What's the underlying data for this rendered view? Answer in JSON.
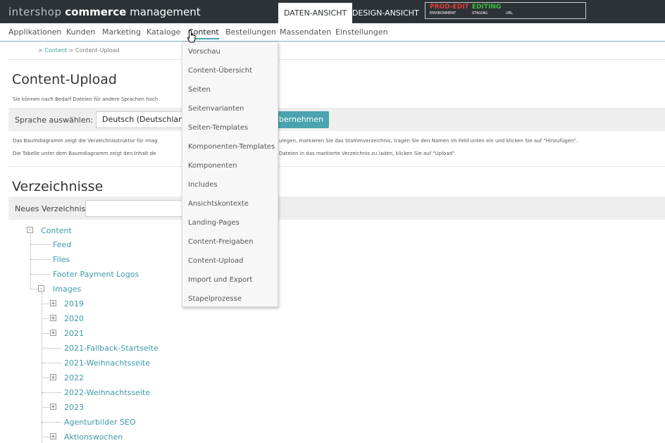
{
  "header": {
    "brand": "intershop",
    "commerce": "commerce",
    "management": "management",
    "view_daten": "DATEN-ANSICHT",
    "view_design": "DESIGN-ANSICHT",
    "env": {
      "environment_value": "PROD-EDIT",
      "staging_value": "EDITING",
      "environment_label": "ENVIRONMENT",
      "staging_label": "STAGING",
      "url_label": "URL"
    }
  },
  "nav": {
    "items": [
      "Applikationen",
      "Kunden",
      "Marketing",
      "Kataloge",
      "Content",
      "Bestellungen",
      "Massendaten",
      "Einstellungen"
    ],
    "active": "Content"
  },
  "breadcrumb": {
    "sep": ">",
    "content": "Content",
    "current": "Content-Upload"
  },
  "page": {
    "title": "Content-Upload",
    "note": "Sie können nach Bedarf Dateien für andere Sprachen hoch",
    "lang_label": "Sprache auswählen:",
    "lang_value": "Deutsch (Deutschland)",
    "apply_button": "Übernehmen",
    "info1_start": "Das Baumdiagramm zeigt die Verzeichnisstruktur für imag",
    "info1_end": "ulegen, markieren Sie das Stammverzeichnis, tragen Sie den Namen im Feld unten ein und klicken Sie auf \"Hinzufügen\".",
    "info2_start": "Die Tabelle unter dem Baumdiagramm zeigt den Inhalt de",
    "info2_end": "Dateien in das markierte Verzeichnis zu laden, klicken Sie auf \"Upload\".",
    "section_title": "Verzeichnisse",
    "new_dir_label": "Neues Verzeichnis:"
  },
  "tree": {
    "root": "Content",
    "level1": [
      "Feed",
      "Files",
      "Footer Payment Logos",
      "Images"
    ],
    "images_children": [
      "2019",
      "2020",
      "2021",
      "2021-Fallback-Startseite",
      "2021-Weihnachtsseite",
      "2022",
      "2022-Weihnachtsseite",
      "2023",
      "Agenturbilder SEO",
      "Aktionswochen"
    ],
    "toggle_plus": "+",
    "toggle_minus": "-"
  },
  "dropdown": {
    "items": [
      "Vorschau",
      "Content-Übersicht",
      "Seiten",
      "Seitenvarianten",
      "Seiten-Templates",
      "Komponenten-Templates",
      "Komponenten",
      "Includes",
      "Ansichtskontexte",
      "Landing-Pages",
      "Content-Freigaben",
      "Content-Upload",
      "Import und Export",
      "Stapelprozesse"
    ]
  }
}
